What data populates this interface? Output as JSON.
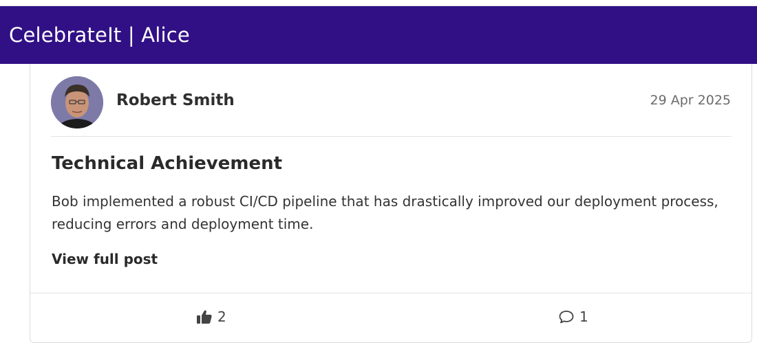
{
  "header": {
    "title": "CelebrateIt | Alice"
  },
  "post": {
    "author": "Robert Smith",
    "date": "29 Apr 2025",
    "title": "Technical Achievement",
    "body": "Bob implemented a robust CI/CD pipeline that has drastically improved our deployment process, reducing errors and deployment time.",
    "view_link": "View full post",
    "likes": "2",
    "comments": "1"
  },
  "icons": {
    "like": "thumbs-up-icon",
    "comment": "comment-bubble-icon"
  },
  "colors": {
    "header_bg": "#311086",
    "header_text": "#ffffff"
  }
}
